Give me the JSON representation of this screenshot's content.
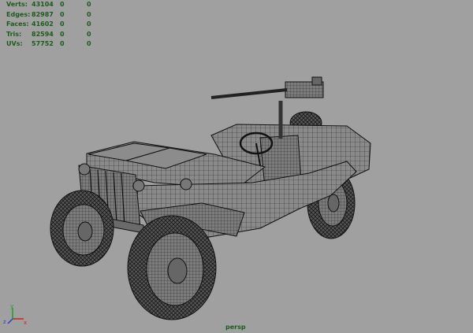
{
  "viewport": {
    "camera_label": "persp",
    "background_color": "#a0a0a0",
    "hud_color": "#1d5a1d"
  },
  "heads_up_display": {
    "rows": [
      {
        "label": "Verts:",
        "total": "43104",
        "selected": "0",
        "component": "0"
      },
      {
        "label": "Edges:",
        "total": "82987",
        "selected": "0",
        "component": "0"
      },
      {
        "label": "Faces:",
        "total": "41602",
        "selected": "0",
        "component": "0"
      },
      {
        "label": "Tris:",
        "total": "82594",
        "selected": "0",
        "component": "0"
      },
      {
        "label": "UVs:",
        "total": "57752",
        "selected": "0",
        "component": "0"
      }
    ]
  },
  "axis_gizmo": {
    "x_label": "x",
    "y_label": "y",
    "z_label": "z",
    "colors": {
      "x": "#cc2020",
      "y": "#20a020",
      "z": "#2040d0"
    }
  }
}
